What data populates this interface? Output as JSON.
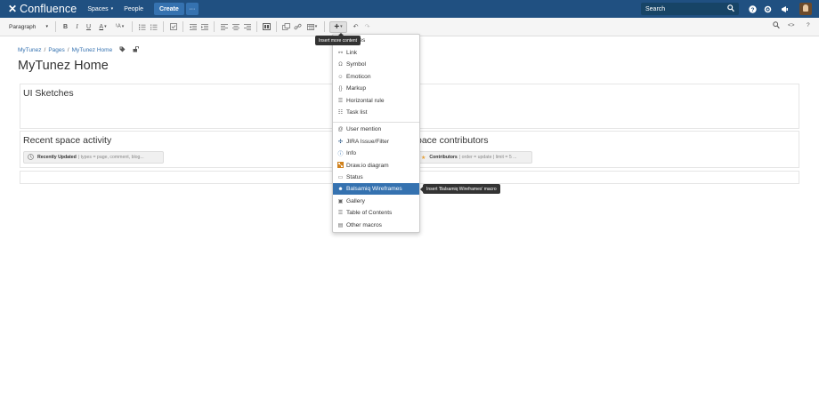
{
  "topnav": {
    "logo_text": "Confluence",
    "spaces": "Spaces",
    "people": "People",
    "create": "Create",
    "more": "···",
    "search_placeholder": "Search",
    "help_icon": "help-icon",
    "settings_icon": "gear-icon",
    "notifications_icon": "megaphone-icon"
  },
  "toolbar": {
    "paragraph": "Paragraph",
    "bold": "B",
    "italic": "I",
    "underline": "U",
    "text_color": "A",
    "more_format": "¹A",
    "insert_more": "+",
    "undo": "↶",
    "redo": "↷",
    "find": "⌕",
    "source": "<>",
    "help": "?"
  },
  "breadcrumb": {
    "items": [
      "MyTunez",
      "Pages",
      "MyTunez Home"
    ]
  },
  "page": {
    "title": "MyTunez Home",
    "sections": {
      "sketches_heading": "UI Sketches",
      "recent_heading": "Recent space activity",
      "recent_macro_name": "Recently Updated",
      "recent_macro_params": "| types = page, comment, blog...",
      "contributors_heading": "pace contributors",
      "contributors_macro_name": "Contributors",
      "contributors_macro_params": "| order = update | limit = 5 ..."
    }
  },
  "insert_menu": {
    "items_top": [
      {
        "label": "images",
        "icon": "image-icon"
      },
      {
        "label": "Link",
        "icon": "link-icon"
      },
      {
        "label": "Symbol",
        "icon": "omega-icon"
      },
      {
        "label": "Emoticon",
        "icon": "smiley-icon"
      },
      {
        "label": "Markup",
        "icon": "braces-icon"
      },
      {
        "label": "Horizontal rule",
        "icon": "rule-icon"
      },
      {
        "label": "Task list",
        "icon": "task-list-icon"
      }
    ],
    "items_bottom": [
      {
        "label": "User mention",
        "icon": "at-icon"
      },
      {
        "label": "JIRA Issue/Filter",
        "icon": "jira-icon"
      },
      {
        "label": "Info",
        "icon": "info-icon"
      },
      {
        "label": "Draw.io diagram",
        "icon": "drawio-icon"
      },
      {
        "label": "Status",
        "icon": "status-icon"
      },
      {
        "label": "Balsamiq Wireframes",
        "icon": "balsamiq-icon",
        "selected": true
      },
      {
        "label": "Gallery",
        "icon": "gallery-icon"
      },
      {
        "label": "Table of Contents",
        "icon": "toc-icon"
      },
      {
        "label": "Other macros",
        "icon": "macro-icon"
      }
    ]
  },
  "tooltips": {
    "insert_more": "Insert more content",
    "balsamiq_macro": "Insert 'Balsamiq Wireframes' macro"
  },
  "colors": {
    "header": "#205081",
    "accent": "#3572b0"
  }
}
